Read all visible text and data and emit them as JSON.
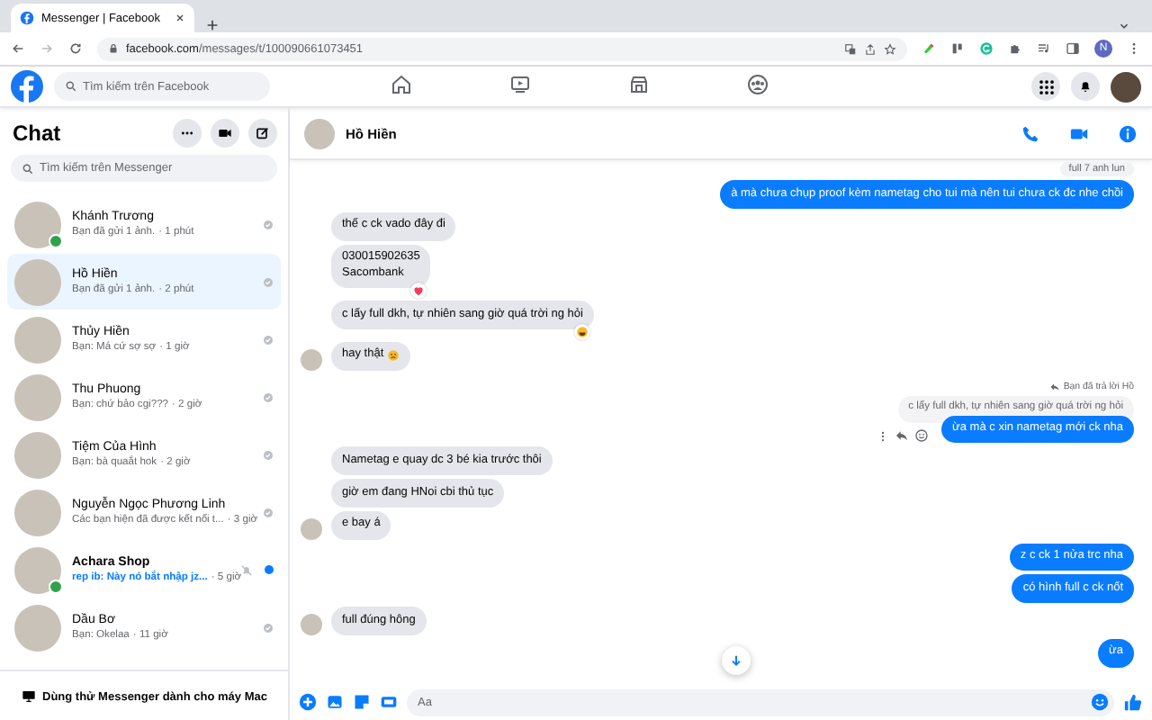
{
  "browser": {
    "tab_title": "Messenger | Facebook",
    "url_domain": "facebook.com",
    "url_path": "/messages/t/100090661073451",
    "profile_initial": "N"
  },
  "facebook_bar": {
    "search_placeholder": "Tìm kiếm trên Facebook",
    "nav": [
      {
        "kind": "home",
        "selected": false
      },
      {
        "kind": "watch",
        "selected": false
      },
      {
        "kind": "marketplace",
        "selected": false
      },
      {
        "kind": "groups",
        "selected": false
      }
    ]
  },
  "sidebar": {
    "title": "Chat",
    "search_placeholder": "Tìm kiếm trên Messenger",
    "conversations": [
      {
        "name": "Khánh Trương",
        "preview": "Bạn đã gửi 1 ảnh.",
        "time": "· 1 phút",
        "selected": false,
        "unread": false,
        "online": true,
        "muted": false
      },
      {
        "name": "Hồ Hiền",
        "preview": "Bạn đã gửi 1 ảnh.",
        "time": "· 2 phút",
        "selected": true,
        "unread": false,
        "online": false,
        "muted": false
      },
      {
        "name": "Thủy Hiền",
        "preview": "Bạn: Má cứ sợ sợ",
        "time": "· 1 giờ",
        "selected": false,
        "unread": false,
        "online": false,
        "muted": false
      },
      {
        "name": "Thu Phuong",
        "preview": "Bạn: chứ bảo cgi???",
        "time": "· 2 giờ",
        "selected": false,
        "unread": false,
        "online": false,
        "muted": false
      },
      {
        "name": "Tiệm Của Hình",
        "preview": "Bạn: bà quaắt hok",
        "time": "· 2 giờ",
        "selected": false,
        "unread": false,
        "online": false,
        "muted": false
      },
      {
        "name": "Nguyễn Ngọc Phương Linh",
        "preview": "Các bạn hiện đã được kết nối t...",
        "time": "· 3 giờ",
        "selected": false,
        "unread": false,
        "online": false,
        "muted": false
      },
      {
        "name": "Achara Shop",
        "preview": "rep ib: Này nó bắt nhập jz...",
        "time": "· 5 giờ",
        "selected": false,
        "unread": true,
        "online": true,
        "muted": true
      },
      {
        "name": "Dầu Bơ",
        "preview": "Bạn: Okelaa",
        "time": "· 11 giờ",
        "selected": false,
        "unread": false,
        "online": false,
        "muted": false
      }
    ],
    "footer": "Dùng thử Messenger dành cho máy Mac"
  },
  "chat": {
    "contact_name": "Hồ Hiền",
    "messages": [
      {
        "kind": "caption",
        "text": "full 7 anh lun"
      },
      {
        "kind": "out",
        "text": "à mà chưa chụp proof kèm nametag cho tui mà nên tui chưa ck đc nhe chồi"
      },
      {
        "kind": "in",
        "text": "thế c ck vado đây đi",
        "avatar": false
      },
      {
        "kind": "in",
        "text": "030015902635\nSacombank",
        "avatar": false,
        "reaction": {
          "kind": "heart"
        }
      },
      {
        "kind": "in",
        "text": "c lấy full dkh, tự nhiên sang giờ quá trời ng hỏi",
        "avatar": false,
        "reaction": {
          "kind": "laugh"
        }
      },
      {
        "kind": "in",
        "text": "hay thật",
        "avatar": true,
        "trailing_emoji": true
      },
      {
        "kind": "reply_note",
        "text": "Bạn đã trả lời Hồ"
      },
      {
        "kind": "quote",
        "text": "c lấy full dkh, tự nhiên sang giờ quá trời ng hỏi"
      },
      {
        "kind": "out",
        "text": "ừa mà c xin nametag mới ck nha",
        "actions": true
      },
      {
        "kind": "in",
        "text": "Nametag e quay dc 3 bé kia trước thôi",
        "avatar": false
      },
      {
        "kind": "in",
        "text": "giờ em đang HNoi cbi thủ tục",
        "avatar": false
      },
      {
        "kind": "in",
        "text": "e bay á",
        "avatar": true
      },
      {
        "kind": "out",
        "text": "z c ck 1 nửa trc nha"
      },
      {
        "kind": "out",
        "text": "có hình full c ck nốt"
      },
      {
        "kind": "in",
        "text": "full đúng hông",
        "avatar": true
      },
      {
        "kind": "out",
        "text": "ừa"
      }
    ],
    "composer_placeholder": "Aa"
  }
}
